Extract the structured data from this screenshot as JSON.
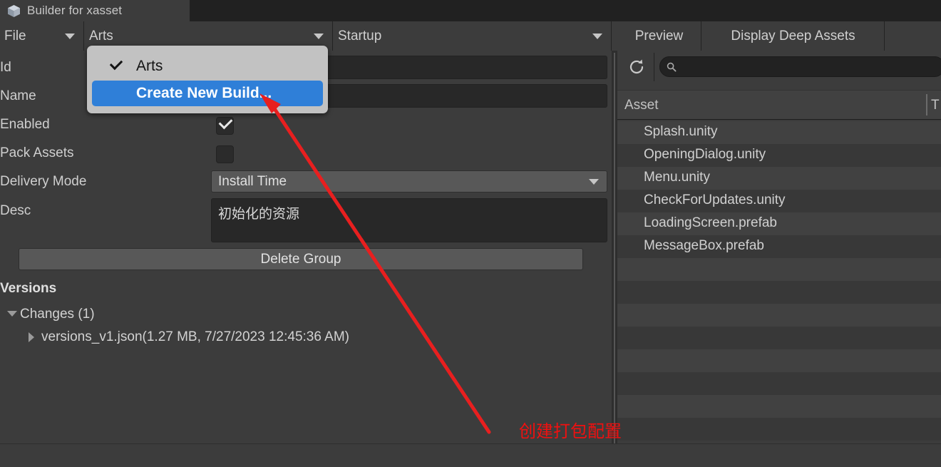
{
  "window": {
    "tab_title": "Builder for xasset",
    "tab_icon": "package-box-icon"
  },
  "toolbar": {
    "file_menu": "File",
    "build_selector": "Arts",
    "group_selector": "Startup",
    "preview_button": "Preview",
    "display_deep_assets_button": "Display Deep Assets",
    "refresh_icon": "refresh-icon",
    "search_icon": "search-icon",
    "search_value": "",
    "search_placeholder": ""
  },
  "dropdown_menu": {
    "open": true,
    "items": [
      {
        "label": "Arts",
        "checked": true,
        "highlighted": false
      },
      {
        "label": "Create New Build...",
        "checked": false,
        "highlighted": true
      }
    ],
    "highlight_color": "#2f7fd8",
    "panel_color": "#c2c2c2"
  },
  "inspector": {
    "fields": [
      {
        "label": "Id",
        "type": "text",
        "value": ""
      },
      {
        "label": "Name",
        "type": "text",
        "value": ""
      },
      {
        "label": "Enabled",
        "type": "checkbox",
        "checked": true
      },
      {
        "label": "Pack Assets",
        "type": "checkbox",
        "checked": false
      },
      {
        "label": "Delivery Mode",
        "type": "dropdown",
        "value": "Install Time"
      },
      {
        "label": "Desc",
        "type": "textarea",
        "value": "初始化的资源"
      }
    ],
    "delete_group_button": "Delete Group"
  },
  "versions": {
    "title": "Versions",
    "changes_label": "Changes (1)",
    "changes_expanded": true,
    "entries": [
      {
        "label": "versions_v1.json(1.27 MB, 7/27/2023 12:45:36 AM)",
        "expanded": false
      }
    ]
  },
  "asset_list": {
    "columns": [
      "Asset",
      "T"
    ],
    "rows": [
      {
        "asset": "Splash.unity"
      },
      {
        "asset": "OpeningDialog.unity"
      },
      {
        "asset": "Menu.unity"
      },
      {
        "asset": "CheckForUpdates.unity"
      },
      {
        "asset": "LoadingScreen.prefab"
      },
      {
        "asset": "MessageBox.prefab"
      }
    ]
  },
  "annotation": {
    "text": "创建打包配置",
    "color": "#f01010",
    "arrow": "red-arrow-pointer"
  }
}
